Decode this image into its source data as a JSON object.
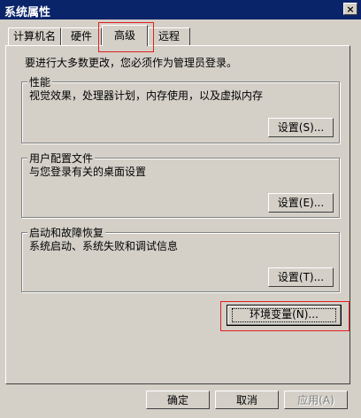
{
  "window": {
    "title": "系统属性",
    "close_symbol": "×"
  },
  "tabs": [
    {
      "label": "计算机名"
    },
    {
      "label": "硬件"
    },
    {
      "label": "高级"
    },
    {
      "label": "远程"
    }
  ],
  "intro_text": "要进行大多数更改，您必须作为管理员登录。",
  "groups": {
    "performance": {
      "title": "性能",
      "description": "视觉效果，处理器计划，内存使用，以及虚拟内存",
      "button": "设置(S)..."
    },
    "user_profiles": {
      "title": "用户配置文件",
      "description": "与您登录有关的桌面设置",
      "button": "设置(E)..."
    },
    "startup_recovery": {
      "title": "启动和故障恢复",
      "description": "系统启动、系统失败和调试信息",
      "button": "设置(T)..."
    }
  },
  "env_button": "环境变量(N)...",
  "footer": {
    "ok": "确定",
    "cancel": "取消",
    "apply": "应用(A)"
  },
  "highlight_color": "#e02020"
}
